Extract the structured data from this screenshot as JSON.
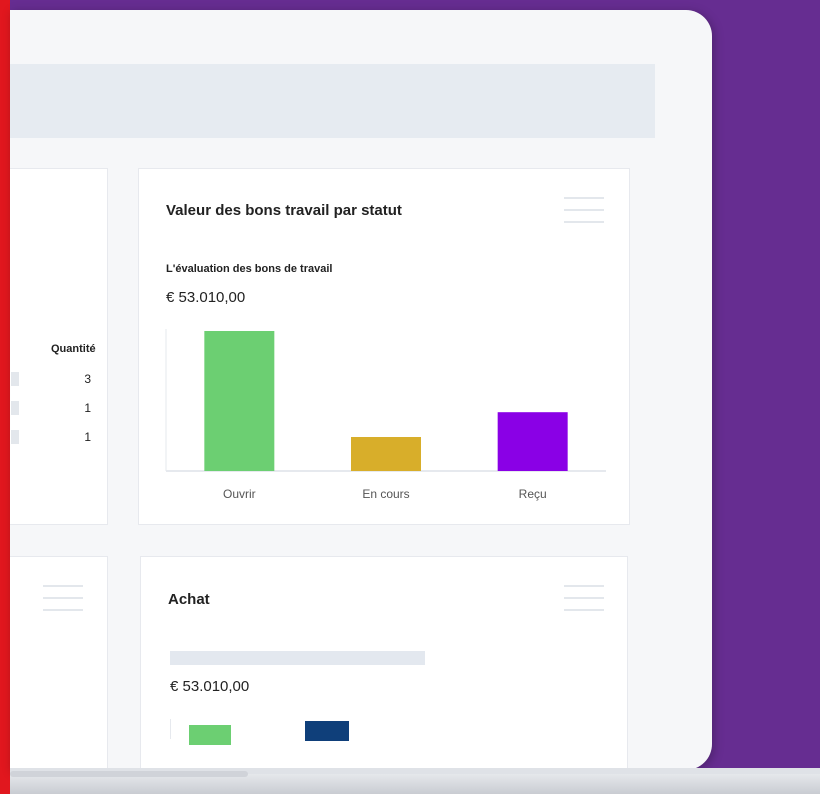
{
  "colors": {
    "background": "#662d91",
    "accent_red": "#e1171e",
    "bar_open": "#6ccf72",
    "bar_in_progress": "#d8ae2a",
    "bar_received": "#8a00e6",
    "bar_navy": "#0f3f7a"
  },
  "left_card": {
    "qty_header": "Quantité",
    "rows": [
      "3",
      "1",
      "1"
    ]
  },
  "work_orders_card": {
    "title": "Valeur des bons travail par statut",
    "subtitle": "L'évaluation des bons de travail",
    "amount": "€ 53.010,00",
    "menu_icon": "hamburger-menu-icon",
    "chart_data": {
      "type": "bar",
      "categories": [
        "Ouvrir",
        "En cours",
        "Reçu"
      ],
      "values": [
        35000,
        8500,
        14700
      ],
      "ylim": [
        0,
        35000
      ],
      "colors": [
        "#6ccf72",
        "#d8ae2a",
        "#8a00e6"
      ],
      "grid": false,
      "legend": "none"
    }
  },
  "purchase_card": {
    "title": "Achat",
    "amount": "€ 53.010,00",
    "menu_icon": "hamburger-menu-icon"
  },
  "bottom_left_card": {
    "menu_icon": "hamburger-menu-icon"
  }
}
